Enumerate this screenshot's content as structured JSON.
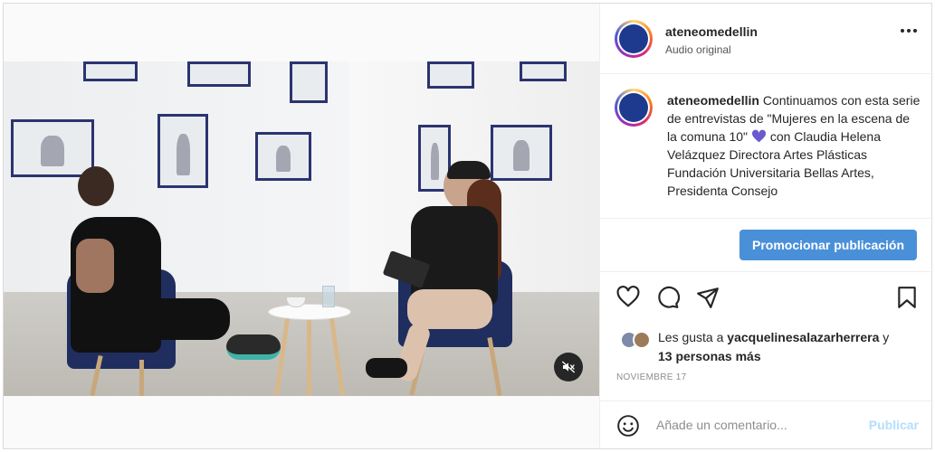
{
  "header": {
    "username": "ateneomedellin",
    "audio": "Audio original"
  },
  "caption": {
    "username": "ateneomedellin",
    "text_before_heart": "Continuamos con esta serie de entrevistas de \"Mujeres en la escena de la comuna 10\"",
    "text_after_heart": "con Claudia Helena Velázquez Directora Artes Plásticas Fundación Universitaria Bellas Artes, Presidenta Consejo"
  },
  "promote": {
    "label": "Promocionar publicación"
  },
  "actions": {
    "like_icon": "heart-outline-icon",
    "comment_icon": "comment-bubble-icon",
    "share_icon": "paper-plane-icon",
    "save_icon": "bookmark-icon"
  },
  "likes": {
    "prefix": "Les gusta a",
    "user": "yacquelinesalazarherrera",
    "joiner": "y",
    "others": "13 personas más"
  },
  "date": "NOVIEMBRE 17",
  "comment": {
    "placeholder": "Añade un comentario...",
    "publish": "Publicar"
  },
  "colors": {
    "accent": "#4a90d9",
    "publish_disabled": "#b2dffc",
    "heart_purple": "#6a5acd"
  }
}
